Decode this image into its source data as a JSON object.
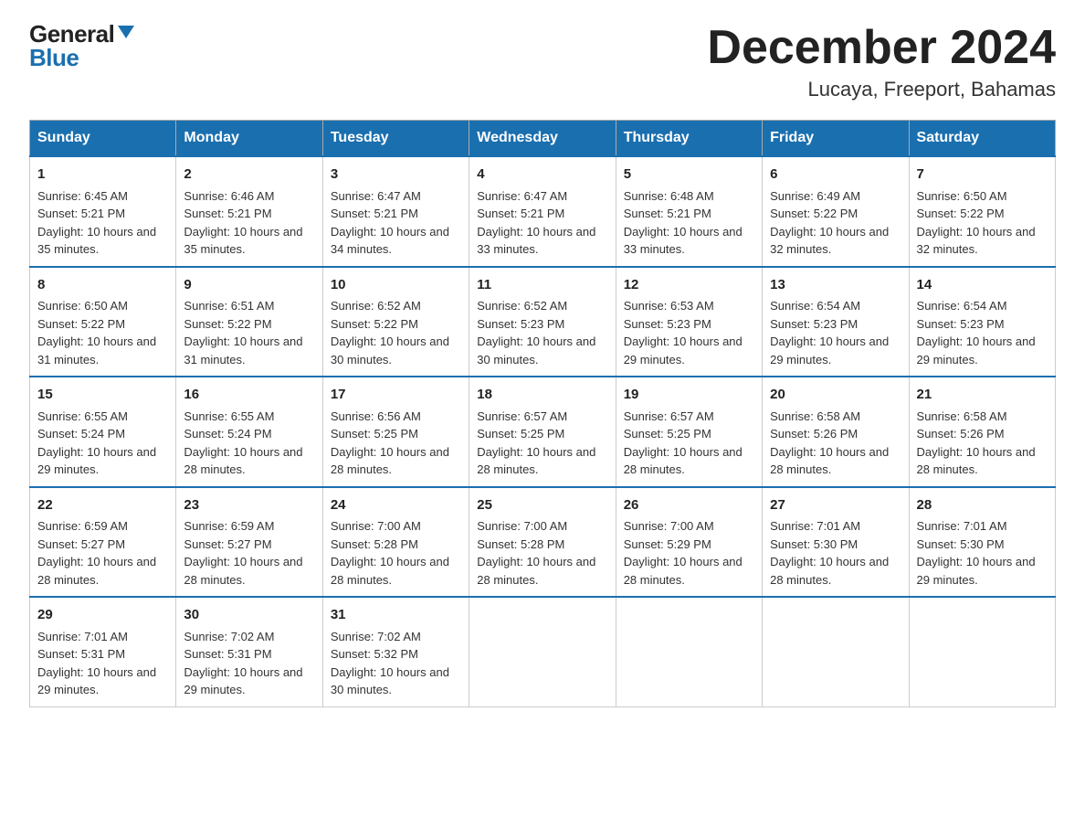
{
  "logo": {
    "general": "General",
    "blue": "Blue"
  },
  "title": {
    "month_year": "December 2024",
    "location": "Lucaya, Freeport, Bahamas"
  },
  "weekdays": [
    "Sunday",
    "Monday",
    "Tuesday",
    "Wednesday",
    "Thursday",
    "Friday",
    "Saturday"
  ],
  "weeks": [
    [
      {
        "day": "1",
        "sunrise": "6:45 AM",
        "sunset": "5:21 PM",
        "daylight": "10 hours and 35 minutes."
      },
      {
        "day": "2",
        "sunrise": "6:46 AM",
        "sunset": "5:21 PM",
        "daylight": "10 hours and 35 minutes."
      },
      {
        "day": "3",
        "sunrise": "6:47 AM",
        "sunset": "5:21 PM",
        "daylight": "10 hours and 34 minutes."
      },
      {
        "day": "4",
        "sunrise": "6:47 AM",
        "sunset": "5:21 PM",
        "daylight": "10 hours and 33 minutes."
      },
      {
        "day": "5",
        "sunrise": "6:48 AM",
        "sunset": "5:21 PM",
        "daylight": "10 hours and 33 minutes."
      },
      {
        "day": "6",
        "sunrise": "6:49 AM",
        "sunset": "5:22 PM",
        "daylight": "10 hours and 32 minutes."
      },
      {
        "day": "7",
        "sunrise": "6:50 AM",
        "sunset": "5:22 PM",
        "daylight": "10 hours and 32 minutes."
      }
    ],
    [
      {
        "day": "8",
        "sunrise": "6:50 AM",
        "sunset": "5:22 PM",
        "daylight": "10 hours and 31 minutes."
      },
      {
        "day": "9",
        "sunrise": "6:51 AM",
        "sunset": "5:22 PM",
        "daylight": "10 hours and 31 minutes."
      },
      {
        "day": "10",
        "sunrise": "6:52 AM",
        "sunset": "5:22 PM",
        "daylight": "10 hours and 30 minutes."
      },
      {
        "day": "11",
        "sunrise": "6:52 AM",
        "sunset": "5:23 PM",
        "daylight": "10 hours and 30 minutes."
      },
      {
        "day": "12",
        "sunrise": "6:53 AM",
        "sunset": "5:23 PM",
        "daylight": "10 hours and 29 minutes."
      },
      {
        "day": "13",
        "sunrise": "6:54 AM",
        "sunset": "5:23 PM",
        "daylight": "10 hours and 29 minutes."
      },
      {
        "day": "14",
        "sunrise": "6:54 AM",
        "sunset": "5:23 PM",
        "daylight": "10 hours and 29 minutes."
      }
    ],
    [
      {
        "day": "15",
        "sunrise": "6:55 AM",
        "sunset": "5:24 PM",
        "daylight": "10 hours and 29 minutes."
      },
      {
        "day": "16",
        "sunrise": "6:55 AM",
        "sunset": "5:24 PM",
        "daylight": "10 hours and 28 minutes."
      },
      {
        "day": "17",
        "sunrise": "6:56 AM",
        "sunset": "5:25 PM",
        "daylight": "10 hours and 28 minutes."
      },
      {
        "day": "18",
        "sunrise": "6:57 AM",
        "sunset": "5:25 PM",
        "daylight": "10 hours and 28 minutes."
      },
      {
        "day": "19",
        "sunrise": "6:57 AM",
        "sunset": "5:25 PM",
        "daylight": "10 hours and 28 minutes."
      },
      {
        "day": "20",
        "sunrise": "6:58 AM",
        "sunset": "5:26 PM",
        "daylight": "10 hours and 28 minutes."
      },
      {
        "day": "21",
        "sunrise": "6:58 AM",
        "sunset": "5:26 PM",
        "daylight": "10 hours and 28 minutes."
      }
    ],
    [
      {
        "day": "22",
        "sunrise": "6:59 AM",
        "sunset": "5:27 PM",
        "daylight": "10 hours and 28 minutes."
      },
      {
        "day": "23",
        "sunrise": "6:59 AM",
        "sunset": "5:27 PM",
        "daylight": "10 hours and 28 minutes."
      },
      {
        "day": "24",
        "sunrise": "7:00 AM",
        "sunset": "5:28 PM",
        "daylight": "10 hours and 28 minutes."
      },
      {
        "day": "25",
        "sunrise": "7:00 AM",
        "sunset": "5:28 PM",
        "daylight": "10 hours and 28 minutes."
      },
      {
        "day": "26",
        "sunrise": "7:00 AM",
        "sunset": "5:29 PM",
        "daylight": "10 hours and 28 minutes."
      },
      {
        "day": "27",
        "sunrise": "7:01 AM",
        "sunset": "5:30 PM",
        "daylight": "10 hours and 28 minutes."
      },
      {
        "day": "28",
        "sunrise": "7:01 AM",
        "sunset": "5:30 PM",
        "daylight": "10 hours and 29 minutes."
      }
    ],
    [
      {
        "day": "29",
        "sunrise": "7:01 AM",
        "sunset": "5:31 PM",
        "daylight": "10 hours and 29 minutes."
      },
      {
        "day": "30",
        "sunrise": "7:02 AM",
        "sunset": "5:31 PM",
        "daylight": "10 hours and 29 minutes."
      },
      {
        "day": "31",
        "sunrise": "7:02 AM",
        "sunset": "5:32 PM",
        "daylight": "10 hours and 30 minutes."
      },
      null,
      null,
      null,
      null
    ]
  ]
}
